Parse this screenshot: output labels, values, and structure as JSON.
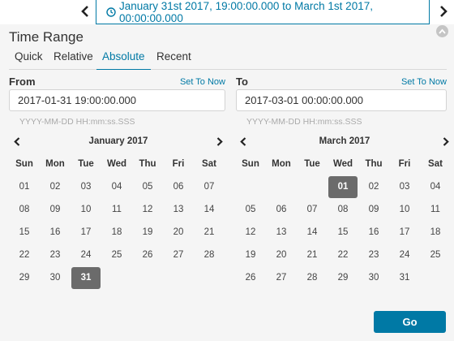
{
  "time_picker": {
    "range_display": "January 31st 2017, 19:00:00.000 to March 1st 2017, 00:00:00.000",
    "prev_icon": "chevron-left-icon",
    "next_icon": "chevron-right-icon",
    "clock_icon": "clock-icon",
    "collapse_icon": "chevron-up-icon"
  },
  "panel": {
    "title": "Time Range",
    "tabs": [
      {
        "label": "Quick",
        "active": false
      },
      {
        "label": "Relative",
        "active": false
      },
      {
        "label": "Absolute",
        "active": true
      },
      {
        "label": "Recent",
        "active": false
      }
    ]
  },
  "from": {
    "label": "From",
    "set_to_now": "Set To Now",
    "value": "2017-01-31 19:00:00.000",
    "format_hint": "YYYY-MM-DD HH:mm:ss.SSS"
  },
  "to": {
    "label": "To",
    "set_to_now": "Set To Now",
    "value": "2017-03-01 00:00:00.000",
    "format_hint": "YYYY-MM-DD HH:mm:ss.SSS"
  },
  "weekdays": [
    "Sun",
    "Mon",
    "Tue",
    "Wed",
    "Thu",
    "Fri",
    "Sat"
  ],
  "calendars": {
    "from": {
      "month_label": "January 2017",
      "selected": "31",
      "weeks": [
        [
          "01",
          "02",
          "03",
          "04",
          "05",
          "06",
          "07"
        ],
        [
          "08",
          "09",
          "10",
          "11",
          "12",
          "13",
          "14"
        ],
        [
          "15",
          "16",
          "17",
          "18",
          "19",
          "20",
          "21"
        ],
        [
          "22",
          "23",
          "24",
          "25",
          "26",
          "27",
          "28"
        ],
        [
          "29",
          "30",
          "31",
          "",
          "",
          "",
          ""
        ]
      ]
    },
    "to": {
      "month_label": "March 2017",
      "selected": "01",
      "weeks": [
        [
          "",
          "",
          "",
          "01",
          "02",
          "03",
          "04"
        ],
        [
          "05",
          "06",
          "07",
          "08",
          "09",
          "10",
          "11"
        ],
        [
          "12",
          "13",
          "14",
          "15",
          "16",
          "17",
          "18"
        ],
        [
          "19",
          "20",
          "21",
          "22",
          "23",
          "24",
          "25"
        ],
        [
          "26",
          "27",
          "28",
          "29",
          "30",
          "31",
          ""
        ]
      ]
    }
  },
  "actions": {
    "go_label": "Go",
    "accent_color": "#0079a5",
    "selected_day_color": "#6b6b6b"
  }
}
